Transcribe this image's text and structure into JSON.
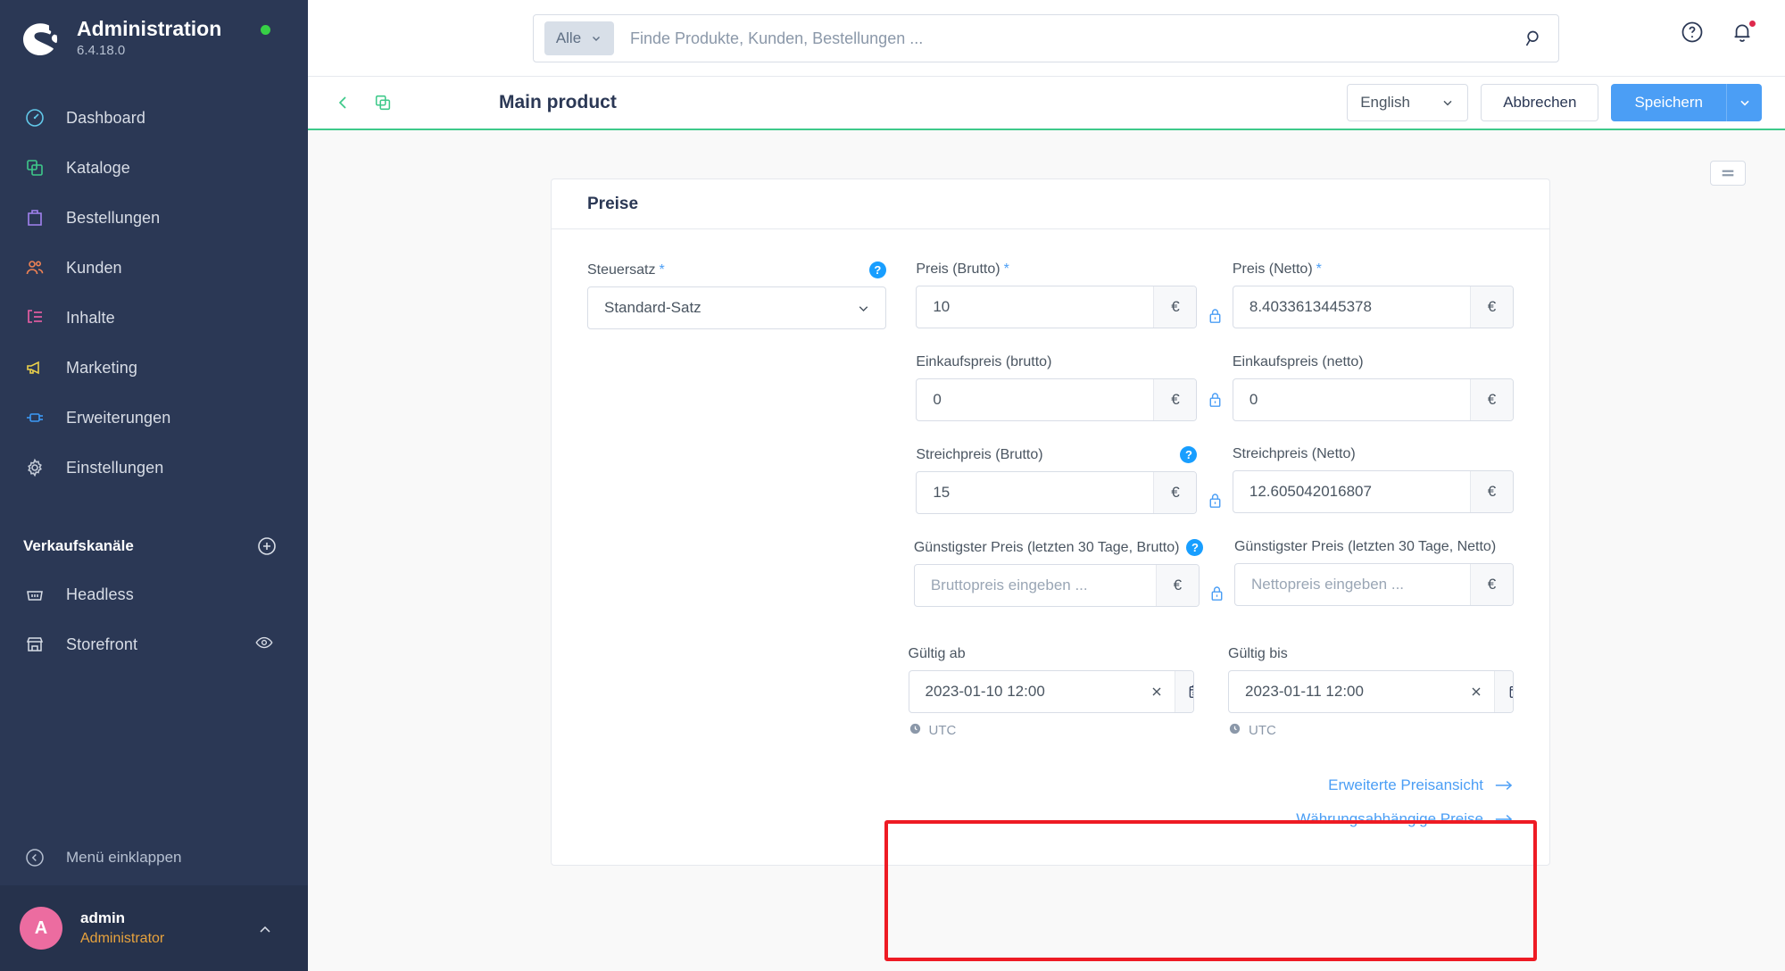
{
  "sidebar": {
    "brand": {
      "title": "Administration",
      "version": "6.4.18.0",
      "status_color": "#37d046"
    },
    "items": [
      {
        "label": "Dashboard",
        "icon": "dashboard-icon",
        "color": "#62c8e9"
      },
      {
        "label": "Kataloge",
        "icon": "catalog-icon",
        "color": "#3ec98a"
      },
      {
        "label": "Bestellungen",
        "icon": "orders-icon",
        "color": "#a282f0"
      },
      {
        "label": "Kunden",
        "icon": "customers-icon",
        "color": "#ef8254"
      },
      {
        "label": "Inhalte",
        "icon": "content-icon",
        "color": "#ee5fa7"
      },
      {
        "label": "Marketing",
        "icon": "marketing-icon",
        "color": "#ecd14a"
      },
      {
        "label": "Erweiterungen",
        "icon": "extensions-icon",
        "color": "#3c9af7"
      },
      {
        "label": "Einstellungen",
        "icon": "settings-gear-icon",
        "color": "#c5ccd8"
      }
    ],
    "sales_channels": {
      "title": "Verkaufskanäle",
      "items": [
        {
          "label": "Headless",
          "icon": "basket-icon"
        },
        {
          "label": "Storefront",
          "icon": "storefront-icon"
        }
      ]
    },
    "collapse_label": "Menü einklappen",
    "user": {
      "initial": "A",
      "name": "admin",
      "role": "Administrator"
    }
  },
  "topbar": {
    "search": {
      "scope_label": "Alle",
      "placeholder": "Finde Produkte, Kunden, Bestellungen ...",
      "value": ""
    },
    "help_icon": "help-circle-icon",
    "notification_icon": "bell-icon"
  },
  "smartbar": {
    "back_icon": "chevron-left-icon",
    "duplicate_icon": "duplicate-icon",
    "title": "Main product",
    "language": "English",
    "cancel_label": "Abbrechen",
    "save_label": "Speichern",
    "accent_color": "#3ec98a",
    "primary_color": "#4b9ef5"
  },
  "content": {
    "sidebar_toggle_icon": "list-toggle-icon",
    "card": {
      "title": "Preise",
      "tax": {
        "label": "Steuersatz",
        "required": true,
        "help": "?",
        "value": "Standard-Satz"
      },
      "rows": [
        {
          "left": {
            "label": "Preis (Brutto)",
            "required": true,
            "value": "10",
            "placeholder": "",
            "suffix": "€",
            "help": ""
          },
          "right": {
            "label": "Preis (Netto)",
            "required": true,
            "value": "8.4033613445378",
            "placeholder": "",
            "suffix": "€"
          },
          "lock": "lock-closed-icon"
        },
        {
          "left": {
            "label": "Einkaufspreis (brutto)",
            "required": false,
            "value": "0",
            "placeholder": "",
            "suffix": "€",
            "help": ""
          },
          "right": {
            "label": "Einkaufspreis (netto)",
            "required": false,
            "value": "0",
            "placeholder": "",
            "suffix": "€"
          },
          "lock": "lock-closed-icon"
        },
        {
          "left": {
            "label": "Streichpreis (Brutto)",
            "required": false,
            "value": "15",
            "placeholder": "",
            "suffix": "€",
            "help": "?"
          },
          "right": {
            "label": "Streichpreis (Netto)",
            "required": false,
            "value": "12.605042016807",
            "placeholder": "",
            "suffix": "€"
          },
          "lock": "lock-closed-icon"
        },
        {
          "left": {
            "label": "Günstigster Preis (letzten 30 Tage, Brutto)",
            "required": false,
            "value": "",
            "placeholder": "Bruttopreis eingeben ...",
            "suffix": "€",
            "help": "?"
          },
          "right": {
            "label": "Günstigster Preis (letzten 30 Tage, Netto)",
            "required": false,
            "value": "",
            "placeholder": "Nettopreis eingeben ...",
            "suffix": "€"
          },
          "lock": "lock-closed-icon"
        }
      ],
      "validity": {
        "highlighted": true,
        "highlight_color": "#ee1b24",
        "from": {
          "label": "Gültig ab",
          "value": "2023-01-10 12:00",
          "timezone": "UTC",
          "calendar_icon": "calendar-icon",
          "clear_icon": "clear-x-icon"
        },
        "to": {
          "label": "Gültig bis",
          "value": "2023-01-11 12:00",
          "timezone": "UTC",
          "calendar_icon": "calendar-icon",
          "clear_icon": "clear-x-icon"
        }
      },
      "links": [
        {
          "label": "Erweiterte Preisansicht",
          "icon": "arrow-right-icon"
        },
        {
          "label": "Währungsabhängige Preise",
          "icon": "arrow-right-icon"
        }
      ]
    }
  }
}
